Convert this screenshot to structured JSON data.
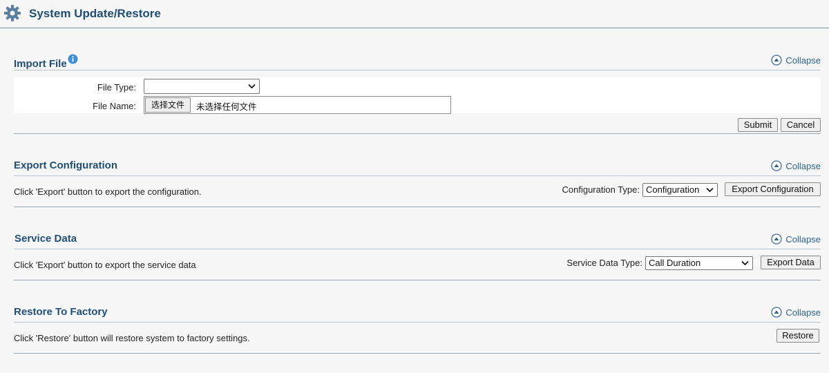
{
  "page": {
    "title": "System Update/Restore",
    "icon": "gear-icon"
  },
  "colors": {
    "heading": "#1f4e79",
    "link": "#2a6496",
    "background": "#f7f7f7"
  },
  "import_file": {
    "title": "Import File",
    "collapse_label": "Collapse",
    "file_type_label": "File Type:",
    "file_type_value": "",
    "file_name_label": "File Name:",
    "choose_file_label": "选择文件",
    "no_file_text": "未选择任何文件",
    "submit_label": "Submit",
    "cancel_label": "Cancel"
  },
  "export_configuration": {
    "title": "Export Configuration",
    "collapse_label": "Collapse",
    "description": "Click 'Export' button to export the configuration.",
    "type_label": "Configuration Type:",
    "type_value": "Configuration",
    "button_label": "Export Configuration"
  },
  "service_data": {
    "title": "Service Data",
    "collapse_label": "Collapse",
    "description": "Click 'Export' button to export the service data",
    "type_label": "Service Data Type:",
    "type_value": "Call Duration",
    "button_label": "Export Data"
  },
  "restore_factory": {
    "title": "Restore To Factory",
    "collapse_label": "Collapse",
    "description": "Click 'Restore' button will restore system to factory settings.",
    "button_label": "Restore"
  }
}
